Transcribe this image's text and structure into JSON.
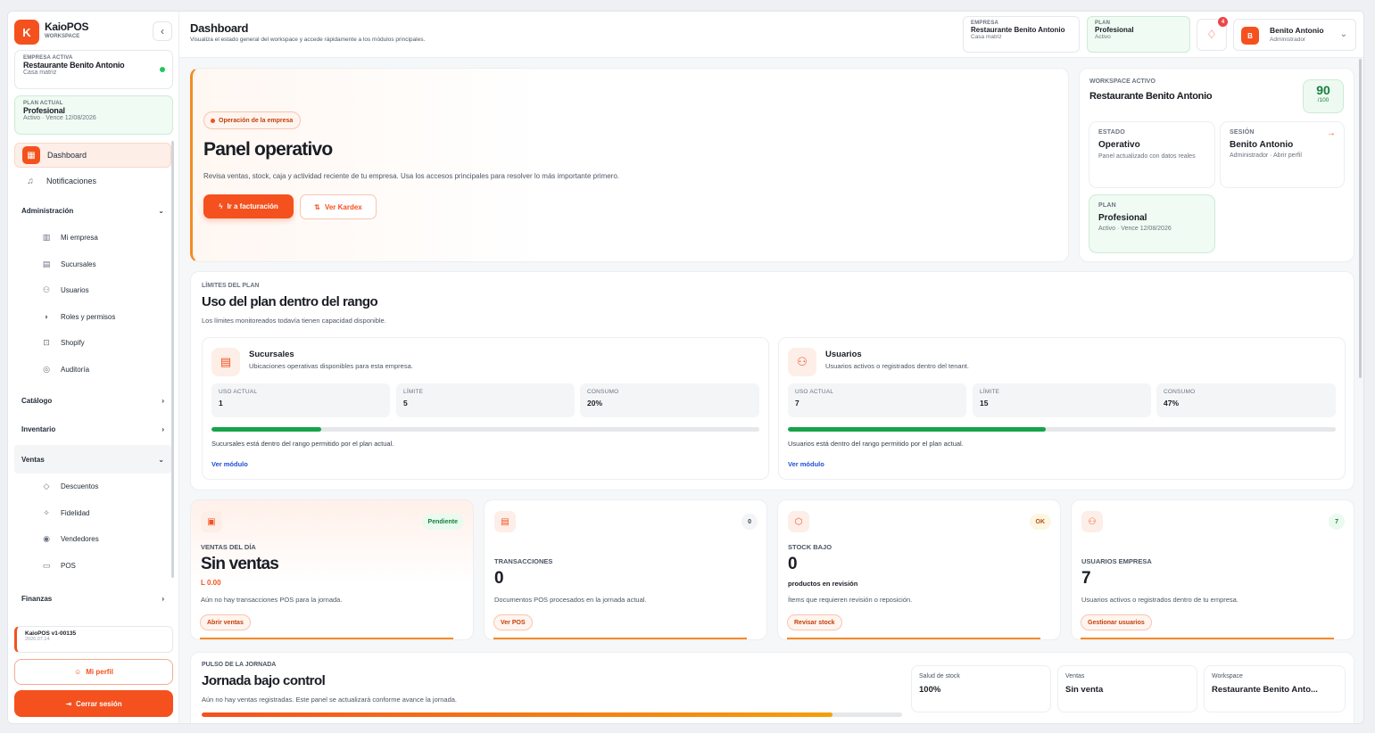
{
  "sidebar": {
    "brand": "KaioPOS",
    "brand_sub": "WORKSPACE",
    "logo_letter": "K",
    "company": {
      "label": "EMPRESA ACTIVA",
      "name": "Restaurante Benito Antonio",
      "sub": "Casa matriz"
    },
    "plan": {
      "label": "PLAN ACTUAL",
      "name": "Profesional",
      "sub": "Activo · Vence 12/08/2026"
    },
    "dashboard": "Dashboard",
    "notifications": "Notificaciones",
    "admin": {
      "label": "Administración",
      "items": [
        "Mi empresa",
        "Sucursales",
        "Usuarios",
        "Roles y permisos",
        "Shopify",
        "Auditoría"
      ]
    },
    "catalog": "Catálogo",
    "inventory": "Inventario",
    "sales": {
      "label": "Ventas",
      "items": [
        "Descuentos",
        "Fidelidad",
        "Vendedores",
        "POS"
      ]
    },
    "finance": "Finanzas",
    "version": "KaioPOS v1-00135",
    "version_date": "2026.07.14",
    "profile_btn": "Mi perfil",
    "logout_btn": "Cerrar sesión"
  },
  "header": {
    "title": "Dashboard",
    "subtitle": "Visualiza el estado general del workspace y accede rápidamente a los módulos principales.",
    "company_label": "EMPRESA",
    "company_name": "Restaurante Benito Antonio",
    "company_sub": "Casa matriz",
    "plan_label": "PLAN",
    "plan_name": "Profesional",
    "plan_sub": "Activo",
    "notif_count": "4",
    "user_initial": "B",
    "user_name": "Benito Antonio",
    "user_role": "Administrador"
  },
  "hero": {
    "tag": "Operación de la empresa",
    "title": "Panel operativo",
    "desc": "Revisa ventas, stock, caja y actividad reciente de tu empresa. Usa los accesos principales para resolver lo más importante primero.",
    "btn_primary": "Ir a facturación",
    "btn_secondary": "Ver Kardex"
  },
  "workspace": {
    "label": "WORKSPACE ACTIVO",
    "name": "Restaurante Benito Antonio",
    "score": "90",
    "score_max": "/100",
    "estado": {
      "label": "ESTADO",
      "value": "Operativo",
      "sub": "Panel actualizado con datos reales"
    },
    "sesion": {
      "label": "SESIÓN",
      "value": "Benito Antonio",
      "sub": "Administrador · Abrir perfil"
    },
    "plan": {
      "label": "PLAN",
      "value": "Profesional",
      "sub": "Activo · Vence 12/08/2026"
    }
  },
  "limits": {
    "label": "LÍMITES DEL PLAN",
    "title": "Uso del plan dentro del rango",
    "sub": "Los límites monitoreados todavía tienen capacidad disponible.",
    "usage_label": "USO ACTUAL",
    "limit_label": "LÍMITE",
    "consumption_label": "CONSUMO",
    "link": "Ver módulo",
    "cards": [
      {
        "title": "Sucursales",
        "desc": "Ubicaciones operativas disponibles para esta empresa.",
        "usage": "1",
        "limit": "5",
        "consumption": "20%",
        "fill": 0.2,
        "note": "Sucursales está dentro del rango permitido por el plan actual."
      },
      {
        "title": "Usuarios",
        "desc": "Usuarios activos o registrados dentro del tenant.",
        "usage": "7",
        "limit": "15",
        "consumption": "47%",
        "fill": 0.47,
        "note": "Usuarios está dentro del rango permitido por el plan actual."
      }
    ]
  },
  "kpis": [
    {
      "badge": "Pendiente",
      "label": "VENTAS DEL DÍA",
      "value": "Sin ventas",
      "amount": "L 0.00",
      "desc": "Aún no hay transacciones POS para la jornada.",
      "btn": "Abrir ventas"
    },
    {
      "badge": "0",
      "label": "TRANSACCIONES",
      "value": "0",
      "desc": "Documentos POS procesados en la jornada actual.",
      "btn": "Ver POS"
    },
    {
      "badge": "OK",
      "label": "STOCK BAJO",
      "value": "0",
      "amount": "productos en revisión",
      "desc": "Ítems que requieren revisión o reposición.",
      "btn": "Revisar stock"
    },
    {
      "badge": "7",
      "label": "USUARIOS EMPRESA",
      "value": "7",
      "desc": "Usuarios activos o registrados dentro de tu empresa.",
      "btn": "Gestionar usuarios"
    }
  ],
  "pulse": {
    "label": "PULSO DE LA JORNADA",
    "title": "Jornada bajo control",
    "sub": "Aún no hay ventas registradas. Este panel se actualizará conforme avance la jornada.",
    "progress": 0.9,
    "stats": [
      {
        "label": "Salud de stock",
        "value": "100%"
      },
      {
        "label": "Ventas",
        "value": "Sin venta"
      },
      {
        "label": "Workspace",
        "value": "Restaurante Benito Anto..."
      }
    ]
  }
}
